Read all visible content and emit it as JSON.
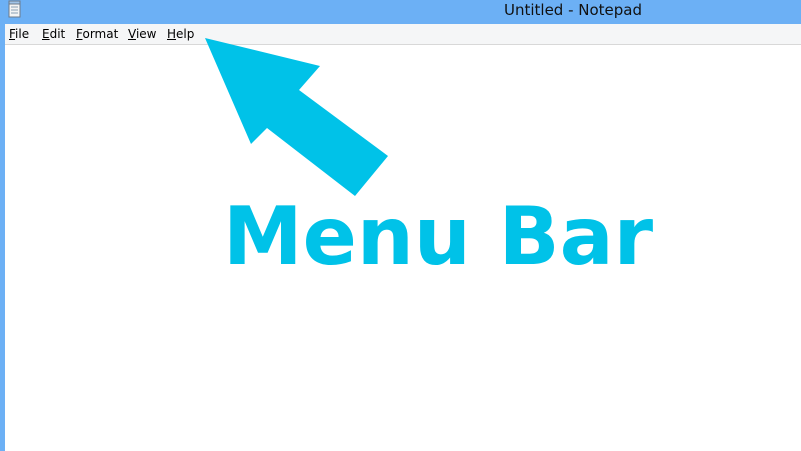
{
  "window": {
    "title": "Untitled - Notepad",
    "app_icon": "notepad-icon",
    "titlebar_color": "#6cb0f5"
  },
  "menubar": {
    "items": [
      {
        "label_accel": "F",
        "label_rest": "ile"
      },
      {
        "label_accel": "E",
        "label_rest": "dit"
      },
      {
        "label_accel": "F",
        "label_rest": "ormat"
      },
      {
        "label_accel": "V",
        "label_rest": "iew"
      },
      {
        "label_accel": "H",
        "label_rest": "elp"
      }
    ]
  },
  "editor": {
    "content": ""
  },
  "annotation": {
    "caption": "Menu Bar",
    "arrow_icon": "arrow-up-left-icon",
    "color": "#00c2e8"
  }
}
